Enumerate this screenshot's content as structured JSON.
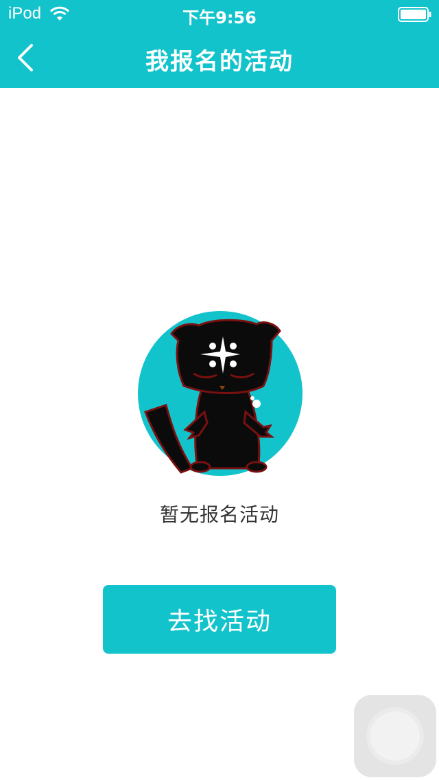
{
  "status_bar": {
    "carrier": "iPod",
    "time": "下午9:56",
    "wifi_icon": "wifi-icon",
    "battery_icon": "battery-icon"
  },
  "nav": {
    "back_icon": "chevron-left-icon",
    "title": "我报名的活动"
  },
  "empty_state": {
    "illustration": "black-cat-mascot-illustration",
    "message": "暂无报名活动"
  },
  "action": {
    "find_label": "去找活动"
  },
  "colors": {
    "accent": "#13c3cc",
    "text": "#333333",
    "background": "#ffffff"
  }
}
